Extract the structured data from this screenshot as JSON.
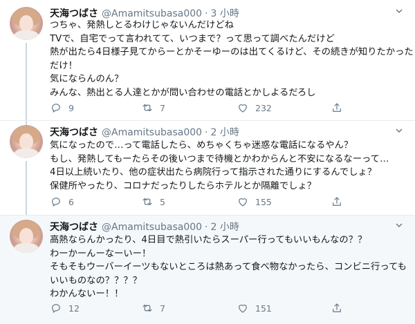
{
  "tweets": [
    {
      "name": "天海つばさ",
      "handle": "@Amamitsubasa000",
      "separator": "·",
      "time": "3 小時",
      "lines": [
        "つちゃ、発熱しとるわけじゃないんだけどね",
        "TVで、自宅でって言われてて、いつまで？って思って調べたんだけど",
        "熱が出たら4日様子見てからーとかそーゆーのは出てくるけど、その続きが知りたかった",
        "だけ！",
        "気にならんのん？",
        "みんな、熱出とる人達とかが問い合わせの電話とかしよるだろし"
      ],
      "replies": "9",
      "retweets": "7",
      "likes": "232"
    },
    {
      "name": "天海つばさ",
      "handle": "@Amamitsubasa000",
      "separator": "·",
      "time": "2 小時",
      "lines": [
        "気になったので…って電話したら、めちゃくちゃ迷惑な電話になるやん？",
        "もし、発熱してもーたらその後いつまで待機とかわからんと不安になるなーって…",
        "4日以上続いたり、他の症状出たら病院行って指示された通りにするんでしょ？",
        "保健所やったり、コロナだったりしたらホテルとか隔離でしょ？"
      ],
      "replies": "6",
      "retweets": "5",
      "likes": "155"
    },
    {
      "name": "天海つばさ",
      "handle": "@Amamitsubasa000",
      "separator": "·",
      "time": "2 小時",
      "lines": [
        "高熱ならんかったり、4日目で熱引いたらスーパー行ってもいいもんなの？？",
        "わーかーんーなーいー！",
        "そもそもウーバーイーツもないところは熱あって食べ物なかったら、コンビニ行っても",
        "いいものなの？？？？",
        "わかんないー！！"
      ],
      "replies": "12",
      "retweets": "7",
      "likes": "151"
    }
  ],
  "icons": {
    "reply": "reply-icon",
    "retweet": "retweet-icon",
    "like": "like-icon",
    "share": "share-icon",
    "more": "chevron-down-icon"
  },
  "colors": {
    "text": "#14171a",
    "secondary": "#657786",
    "thread_line": "#ccd6dd",
    "highlight_bg": "#f5f8fa",
    "divider": "#e6ecf0"
  }
}
